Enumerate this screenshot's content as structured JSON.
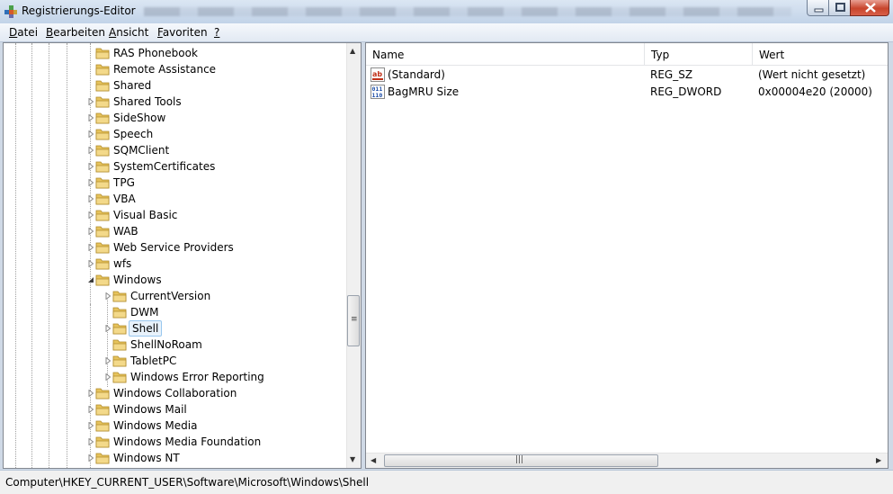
{
  "window": {
    "title": "Registrierungs-Editor"
  },
  "menu": [
    {
      "label": "Datei",
      "key": "D",
      "rest": "atei"
    },
    {
      "label": "Bearbeiten",
      "key": "B",
      "rest": "earbeiten"
    },
    {
      "label": "Ansicht",
      "key": "A",
      "rest": "nsicht"
    },
    {
      "label": "Favoriten",
      "key": "F",
      "rest": "avoriten"
    },
    {
      "label": "?",
      "key": "?",
      "rest": ""
    }
  ],
  "tree": {
    "items": [
      {
        "label": "RAS Phonebook",
        "level": 0,
        "expander": "none"
      },
      {
        "label": "Remote Assistance",
        "level": 0,
        "expander": "none"
      },
      {
        "label": "Shared",
        "level": 0,
        "expander": "none"
      },
      {
        "label": "Shared Tools",
        "level": 0,
        "expander": "collapsed"
      },
      {
        "label": "SideShow",
        "level": 0,
        "expander": "collapsed"
      },
      {
        "label": "Speech",
        "level": 0,
        "expander": "collapsed"
      },
      {
        "label": "SQMClient",
        "level": 0,
        "expander": "collapsed"
      },
      {
        "label": "SystemCertificates",
        "level": 0,
        "expander": "collapsed"
      },
      {
        "label": "TPG",
        "level": 0,
        "expander": "collapsed"
      },
      {
        "label": "VBA",
        "level": 0,
        "expander": "collapsed"
      },
      {
        "label": "Visual Basic",
        "level": 0,
        "expander": "collapsed"
      },
      {
        "label": "WAB",
        "level": 0,
        "expander": "collapsed"
      },
      {
        "label": "Web Service Providers",
        "level": 0,
        "expander": "collapsed"
      },
      {
        "label": "wfs",
        "level": 0,
        "expander": "collapsed"
      },
      {
        "label": "Windows",
        "level": 0,
        "expander": "expanded"
      },
      {
        "label": "CurrentVersion",
        "level": 1,
        "expander": "collapsed"
      },
      {
        "label": "DWM",
        "level": 1,
        "expander": "none"
      },
      {
        "label": "Shell",
        "level": 1,
        "expander": "collapsed",
        "selected": true
      },
      {
        "label": "ShellNoRoam",
        "level": 1,
        "expander": "none"
      },
      {
        "label": "TabletPC",
        "level": 1,
        "expander": "collapsed"
      },
      {
        "label": "Windows Error Reporting",
        "level": 1,
        "expander": "collapsed"
      },
      {
        "label": "Windows Collaboration",
        "level": 0,
        "expander": "collapsed"
      },
      {
        "label": "Windows Mail",
        "level": 0,
        "expander": "collapsed"
      },
      {
        "label": "Windows Media",
        "level": 0,
        "expander": "collapsed"
      },
      {
        "label": "Windows Media Foundation",
        "level": 0,
        "expander": "collapsed"
      },
      {
        "label": "Windows NT",
        "level": 0,
        "expander": "collapsed"
      }
    ]
  },
  "list": {
    "columns": {
      "name": "Name",
      "type": "Typ",
      "value": "Wert"
    },
    "rows": [
      {
        "icon": "string-value-icon",
        "name": "(Standard)",
        "type": "REG_SZ",
        "value": "(Wert nicht gesetzt)"
      },
      {
        "icon": "binary-value-icon",
        "name": "BagMRU Size",
        "type": "REG_DWORD",
        "value": "0x00004e20 (20000)"
      }
    ]
  },
  "statusbar": {
    "path": "Computer\\HKEY_CURRENT_USER\\Software\\Microsoft\\Windows\\Shell"
  },
  "colors": {
    "selection_bg": "#e8f2fb",
    "selection_border": "#99c7ee",
    "folder": "#e6c35c",
    "close_button": "#c8452c"
  }
}
